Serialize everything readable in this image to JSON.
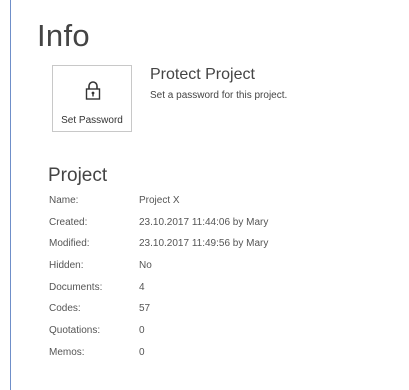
{
  "page": {
    "title": "Info"
  },
  "protect": {
    "button_label": "Set Password",
    "button_icon": "lock-icon",
    "heading": "Protect Project",
    "description": "Set a password for this project."
  },
  "project": {
    "heading": "Project",
    "properties": [
      {
        "label": "Name:",
        "value": "Project X"
      },
      {
        "label": "Created:",
        "value": "23.10.2017 11:44:06 by Mary"
      },
      {
        "label": "Modified:",
        "value": "23.10.2017 11:49:56 by Mary"
      },
      {
        "label": "Hidden:",
        "value": "No"
      },
      {
        "label": "Documents:",
        "value": "4"
      },
      {
        "label": "Codes:",
        "value": "57"
      },
      {
        "label": "Quotations:",
        "value": "0"
      },
      {
        "label": "Memos:",
        "value": "0"
      }
    ]
  },
  "colors": {
    "accent_rule": "#6f8fc9",
    "text": "#444444"
  }
}
